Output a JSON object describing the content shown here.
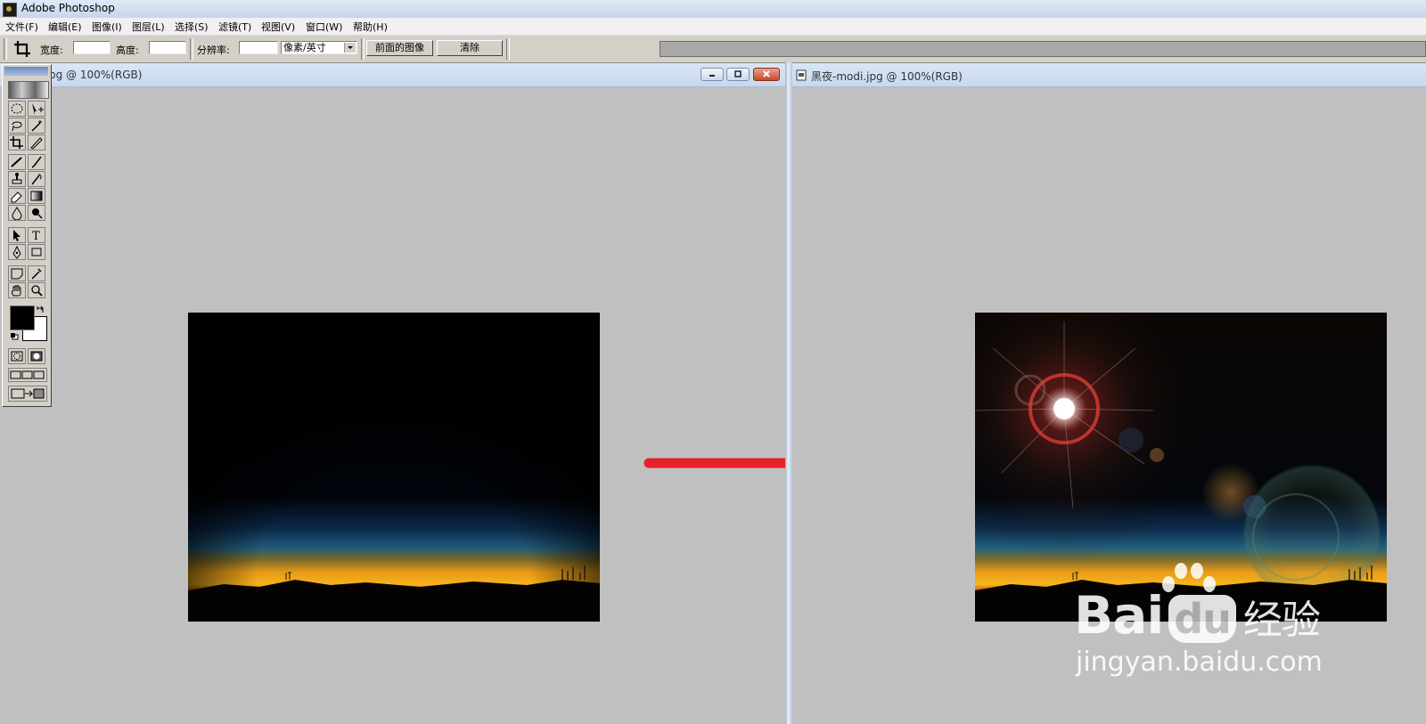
{
  "app": {
    "title": "Adobe Photoshop"
  },
  "menubar": {
    "items": [
      "文件(F)",
      "编辑(E)",
      "图像(I)",
      "图层(L)",
      "选择(S)",
      "滤镜(T)",
      "视图(V)",
      "窗口(W)",
      "帮助(H)"
    ]
  },
  "options_bar": {
    "width_label": "宽度:",
    "width_value": "",
    "height_label": "高度:",
    "height_value": "",
    "resolution_label": "分辨率:",
    "resolution_value": "",
    "unit_select": "像素/英寸",
    "front_image_button": "前面的图像",
    "clear_button": "清除"
  },
  "left_document": {
    "title": "pg @ 100%(RGB)"
  },
  "right_document": {
    "title": "黑夜-modi.jpg @ 100%(RGB)"
  },
  "toolbox": {
    "tools": [
      "marquee-icon",
      "move-icon",
      "lasso-icon",
      "magic-wand-icon",
      "crop-icon",
      "slice-icon",
      "healing-brush-icon",
      "brush-icon",
      "clone-stamp-icon",
      "history-brush-icon",
      "eraser-icon",
      "gradient-icon",
      "blur-icon",
      "dodge-icon",
      "path-selection-icon",
      "type-icon",
      "pen-icon",
      "shape-icon",
      "notes-icon",
      "eyedropper-icon",
      "hand-icon",
      "zoom-icon"
    ],
    "foreground_color": "#000000",
    "background_color": "#ffffff"
  },
  "watermark": {
    "brand_latin": "Bai",
    "brand_du": "du",
    "brand_cn": "经验",
    "url": "jingyan.baidu.com"
  },
  "colors": {
    "arrow": "#e8202a",
    "canvas_gray": "#c0c0c0"
  }
}
